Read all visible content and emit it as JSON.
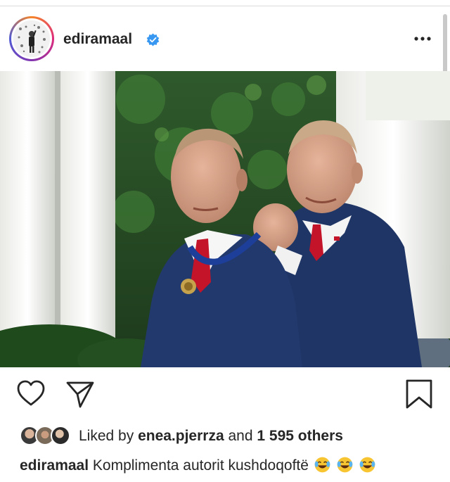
{
  "post": {
    "username": "ediramaal",
    "verified": true,
    "more_icon": "more-dots-icon"
  },
  "photo": {
    "description_icon": "post-photo"
  },
  "actions": {
    "like_icon": "heart-outline-icon",
    "share_icon": "paper-plane-icon",
    "save_icon": "bookmark-outline-icon"
  },
  "likes": {
    "prefix": "Liked by",
    "user": "enea.pjerrza",
    "conjunction": "and",
    "others": "1 595 others"
  },
  "caption": {
    "username": "ediramaal",
    "text": "Komplimenta autorit kushdoqoftë",
    "emoji": "face-with-tears-of-joy-icon"
  },
  "colors": {
    "text": "#262626",
    "verified_blue": "#3897f0",
    "suit_navy": "#1f3566",
    "tie_red": "#c4142a"
  }
}
